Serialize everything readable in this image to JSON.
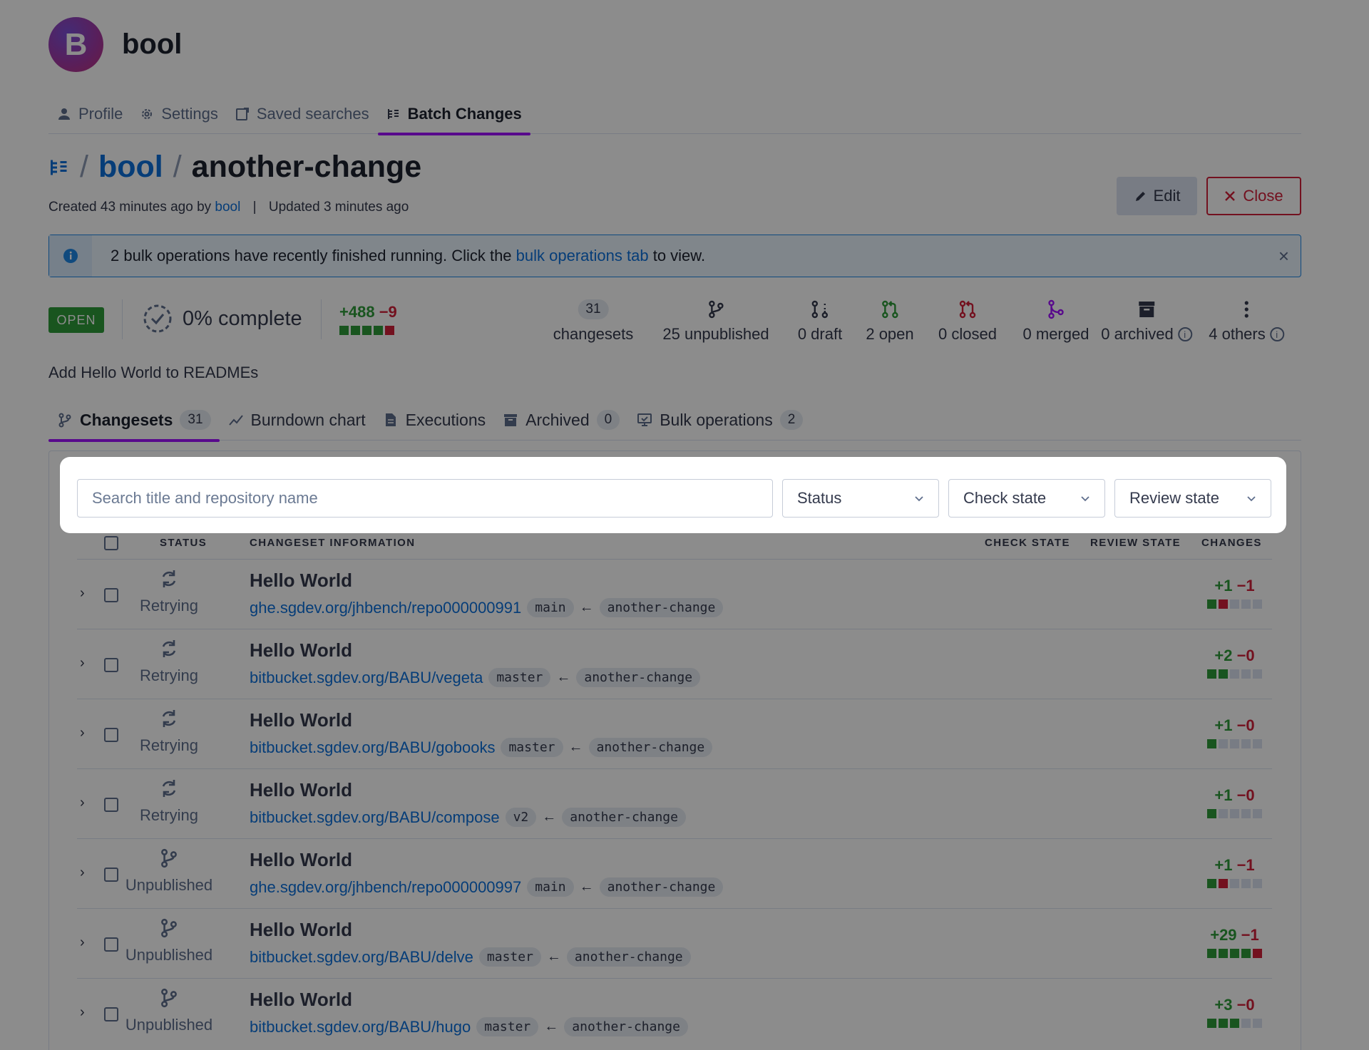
{
  "org": {
    "initial": "B",
    "name": "bool"
  },
  "user_nav": [
    {
      "label": "Profile",
      "icon": "user-icon"
    },
    {
      "label": "Settings",
      "icon": "gear-icon"
    },
    {
      "label": "Saved searches",
      "icon": "saved-search-icon"
    },
    {
      "label": "Batch Changes",
      "icon": "batch-changes-icon",
      "active": true
    }
  ],
  "title": {
    "namespace": "bool",
    "name": "another-change",
    "sep": "/"
  },
  "meta": {
    "created": "Created 43 minutes ago by",
    "author": "bool",
    "bar": "|",
    "updated": "Updated 3 minutes ago"
  },
  "buttons": {
    "edit": "Edit",
    "close": "Close"
  },
  "alert": {
    "text_before": "2 bulk operations have recently finished running. Click the",
    "link": "bulk operations tab",
    "text_after": "to view."
  },
  "summary": {
    "state_badge": "OPEN",
    "progress": "0% complete",
    "progress_fraction": 0,
    "added": "+488",
    "removed": "−9",
    "diff_boxes": [
      "g",
      "g",
      "g",
      "g",
      "r"
    ],
    "stats": [
      {
        "count": "31",
        "label": "changesets"
      },
      {
        "label": "25 unpublished",
        "icon": "unpublished-branch-icon",
        "color": "#343a4d"
      },
      {
        "label": "0 draft",
        "icon": "draft-pr-icon",
        "color": "#343a4d"
      },
      {
        "label": "2 open",
        "icon": "open-pr-icon",
        "color": "#2e9b3a"
      },
      {
        "label": "0 closed",
        "icon": "closed-pr-icon",
        "color": "#d11f3a"
      },
      {
        "label": "0 merged",
        "icon": "merged-icon",
        "color": "#a112ff"
      },
      {
        "label": "0 archived",
        "icon": "archive-icon",
        "color": "#343a4d",
        "info": true
      },
      {
        "label": "4 others",
        "icon": "more-icon",
        "color": "#343a4d",
        "info": true
      }
    ]
  },
  "description": "Add Hello World to READMEs",
  "tabs": [
    {
      "label": "Changesets",
      "count": "31",
      "active": true
    },
    {
      "label": "Burndown chart"
    },
    {
      "label": "Executions"
    },
    {
      "label": "Archived",
      "count": "0"
    },
    {
      "label": "Bulk operations",
      "count": "2"
    }
  ],
  "filters": {
    "search_placeholder": "Search title and repository name",
    "status": "Status",
    "check_state": "Check state",
    "review_state": "Review state"
  },
  "columns": {
    "status": "STATUS",
    "info": "CHANGESET INFORMATION",
    "check": "CHECK STATE",
    "review": "REVIEW STATE",
    "changes": "CHANGES"
  },
  "rows": [
    {
      "status": "Retrying",
      "icon": "retry-icon",
      "title": "Hello World",
      "repo": "ghe.sgdev.org/jhbench/repo000000991",
      "base": "main",
      "head": "another-change",
      "added": "+1",
      "removed": "−1",
      "boxes": [
        "g",
        "r",
        "n",
        "n",
        "n"
      ]
    },
    {
      "status": "Retrying",
      "icon": "retry-icon",
      "title": "Hello World",
      "repo": "bitbucket.sgdev.org/BABU/vegeta",
      "base": "master",
      "head": "another-change",
      "added": "+2",
      "removed": "−0",
      "boxes": [
        "g",
        "g",
        "n",
        "n",
        "n"
      ]
    },
    {
      "status": "Retrying",
      "icon": "retry-icon",
      "title": "Hello World",
      "repo": "bitbucket.sgdev.org/BABU/gobooks",
      "base": "master",
      "head": "another-change",
      "added": "+1",
      "removed": "−0",
      "boxes": [
        "g",
        "n",
        "n",
        "n",
        "n"
      ]
    },
    {
      "status": "Retrying",
      "icon": "retry-icon",
      "title": "Hello World",
      "repo": "bitbucket.sgdev.org/BABU/compose",
      "base": "v2",
      "head": "another-change",
      "added": "+1",
      "removed": "−0",
      "boxes": [
        "g",
        "n",
        "n",
        "n",
        "n"
      ]
    },
    {
      "status": "Unpublished",
      "icon": "unpublished-branch-icon",
      "title": "Hello World",
      "repo": "ghe.sgdev.org/jhbench/repo000000997",
      "base": "main",
      "head": "another-change",
      "added": "+1",
      "removed": "−1",
      "boxes": [
        "g",
        "r",
        "n",
        "n",
        "n"
      ]
    },
    {
      "status": "Unpublished",
      "icon": "unpublished-branch-icon",
      "title": "Hello World",
      "repo": "bitbucket.sgdev.org/BABU/delve",
      "base": "master",
      "head": "another-change",
      "added": "+29",
      "removed": "−1",
      "boxes": [
        "g",
        "g",
        "g",
        "g",
        "r"
      ]
    },
    {
      "status": "Unpublished",
      "icon": "unpublished-branch-icon",
      "title": "Hello World",
      "repo": "bitbucket.sgdev.org/BABU/hugo",
      "base": "master",
      "head": "another-change",
      "added": "+3",
      "removed": "−0",
      "boxes": [
        "g",
        "g",
        "g",
        "n",
        "n"
      ]
    }
  ]
}
